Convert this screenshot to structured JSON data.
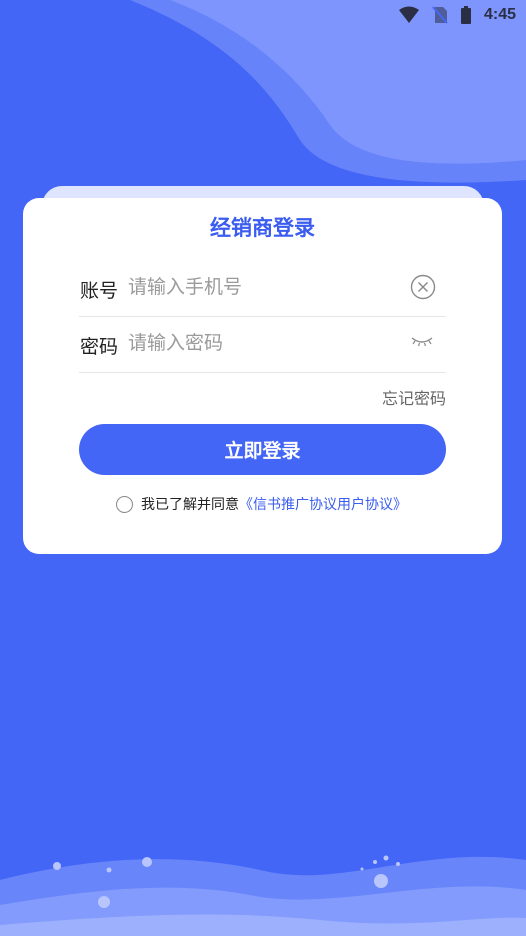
{
  "status_bar": {
    "time": "4:45"
  },
  "card": {
    "title": "经销商登录",
    "account_label": "账号",
    "account_placeholder": "请输入手机号",
    "password_label": "密码",
    "password_placeholder": "请输入密码",
    "forgot_label": "忘记密码",
    "login_label": "立即登录",
    "agree_prefix": "我已了解并同意",
    "agree_link": "《信书推广协议用户协议》"
  },
  "colors": {
    "primary": "#4466f6",
    "title": "#3a5cf0",
    "link": "#3a5cf0"
  },
  "icons": [
    "wifi-icon",
    "no-sim-icon",
    "battery-icon",
    "clear-icon",
    "eye-closed-icon",
    "radio-icon"
  ]
}
